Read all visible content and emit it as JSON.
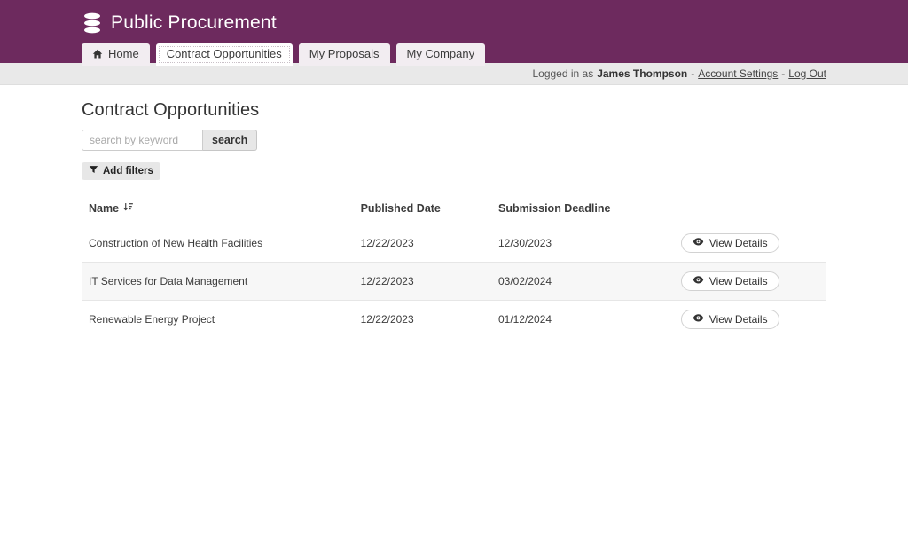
{
  "brand": {
    "title": "Public Procurement"
  },
  "nav": {
    "tabs": [
      {
        "label": "Home",
        "icon": "home-icon",
        "active": false
      },
      {
        "label": "Contract Opportunities",
        "active": true
      },
      {
        "label": "My Proposals",
        "active": false
      },
      {
        "label": "My Company",
        "active": false
      }
    ]
  },
  "userbar": {
    "prefix": "Logged in as",
    "username": "James Thompson",
    "separator": "-",
    "account_settings_label": "Account Settings",
    "logout_label": "Log Out"
  },
  "main": {
    "title": "Contract Opportunities",
    "search": {
      "placeholder": "search by keyword",
      "button_label": "search"
    },
    "filters": {
      "add_label": "Add filters"
    },
    "table": {
      "columns": {
        "name": "Name",
        "published": "Published Date",
        "deadline": "Submission Deadline"
      },
      "rows": [
        {
          "name": "Construction of New Health Facilities",
          "published": "12/22/2023",
          "deadline": "12/30/2023",
          "action": "View Details"
        },
        {
          "name": "IT Services for Data Management",
          "published": "12/22/2023",
          "deadline": "03/02/2024",
          "action": "View Details"
        },
        {
          "name": "Renewable Energy Project",
          "published": "12/22/2023",
          "deadline": "01/12/2024",
          "action": "View Details"
        }
      ]
    }
  },
  "colors": {
    "header_bg": "#6d2a5e",
    "tab_inactive_bg": "#f2edf1",
    "tab_active_bg": "#ffffff",
    "userbar_bg": "#e9e9e9",
    "page_bg": "#ffffff",
    "alt_row_bg": "#f7f7f7",
    "control_bg": "#e7e7e7",
    "text": "#3a3a3a"
  }
}
